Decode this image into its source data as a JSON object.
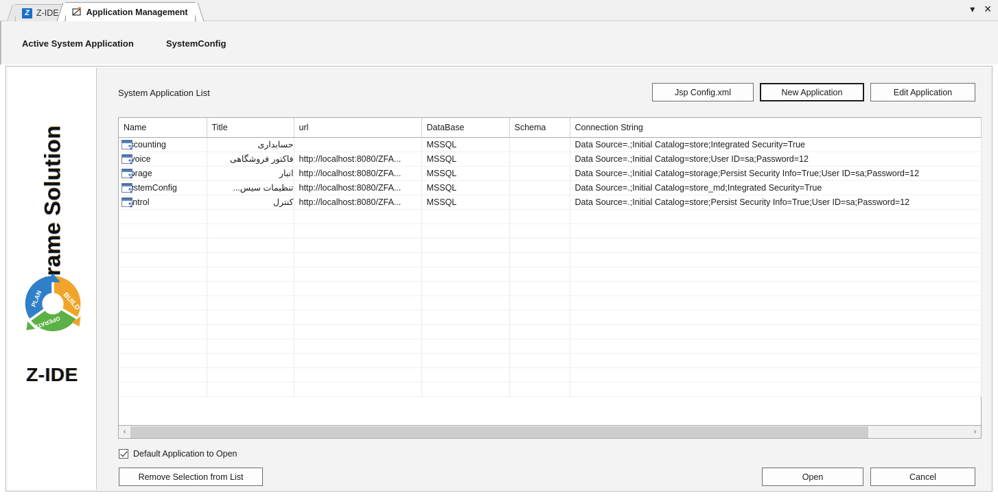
{
  "window": {
    "tabs": [
      {
        "label": "Z-IDE",
        "icon": "z-logo-icon",
        "active": false
      },
      {
        "label": "Application Management",
        "icon": "app-window-icon",
        "active": true
      }
    ],
    "controls": {
      "dropdown": "▾",
      "close": "✕"
    }
  },
  "menubar": {
    "items": [
      {
        "label": "Active System Application"
      },
      {
        "label": "SystemConfig"
      }
    ]
  },
  "brand": {
    "vertical_text": "ZFrame Solution",
    "product_name": "Z-IDE",
    "cycle": {
      "segments": [
        {
          "label": "PLAN",
          "color": "#2f7fc9"
        },
        {
          "label": "BUILD",
          "color": "#f0a42a"
        },
        {
          "label": "OPERATE",
          "color": "#5bb martin"
        }
      ]
    }
  },
  "cycle_labels": {
    "plan": "PLAN",
    "build": "BUILD",
    "operate": "OPERATE"
  },
  "colors": {
    "plan": "#2f7fc9",
    "build": "#f0a42a",
    "operate": "#5cb146",
    "accent_blue": "#1a6fc4",
    "panel_bg": "#f3f3f3",
    "grid_line": "#e9e9e9"
  },
  "main": {
    "list_caption": "System Application List",
    "top_buttons": [
      {
        "label": "Jsp Config.xml",
        "focused": false
      },
      {
        "label": "New Application",
        "focused": true
      },
      {
        "label": "Edit Application",
        "focused": false
      }
    ],
    "grid": {
      "columns": [
        "Name",
        "Title",
        "url",
        "DataBase",
        "Schema",
        "Connection String"
      ],
      "rows": [
        {
          "name": "Accounting",
          "title": "حسابداری",
          "url": "",
          "database": "MSSQL",
          "schema": "",
          "connection": "Data Source=.;Initial Catalog=store;Integrated Security=True"
        },
        {
          "name": "Invoice",
          "title": "فاکتور فروشگاهی",
          "url": "http://localhost:8080/ZFA...",
          "database": "MSSQL",
          "schema": "",
          "connection": "Data Source=.;Initial Catalog=store;User ID=sa;Password=12"
        },
        {
          "name": "storage",
          "title": "انبار",
          "url": "http://localhost:8080/ZFA...",
          "database": "MSSQL",
          "schema": "",
          "connection": "Data Source=.;Initial Catalog=storage;Persist Security Info=True;User ID=sa;Password=12"
        },
        {
          "name": "SystemConfig",
          "title": "تنظیمات سیس...",
          "url": "http://localhost:8080/ZFA...",
          "database": "MSSQL",
          "schema": "",
          "connection": "Data Source=.;Initial Catalog=store_md;Integrated Security=True"
        },
        {
          "name": "control",
          "title": "کنترل",
          "url": "http://localhost:8080/ZFA...",
          "database": "MSSQL",
          "schema": "",
          "connection": "Data Source=.;Initial Catalog=store;Persist Security Info=True;User ID=sa;Password=12"
        }
      ],
      "empty_row_count": 13
    },
    "scrollbar": {
      "left_arrow": "‹",
      "right_arrow": "›",
      "thumb_percent": 88
    },
    "checkbox": {
      "label": "Default Application to Open",
      "checked": true
    },
    "remove_button": {
      "label": "Remove Selection from List"
    },
    "bottom_buttons": [
      {
        "label": "Open"
      },
      {
        "label": "Cancel"
      }
    ]
  }
}
